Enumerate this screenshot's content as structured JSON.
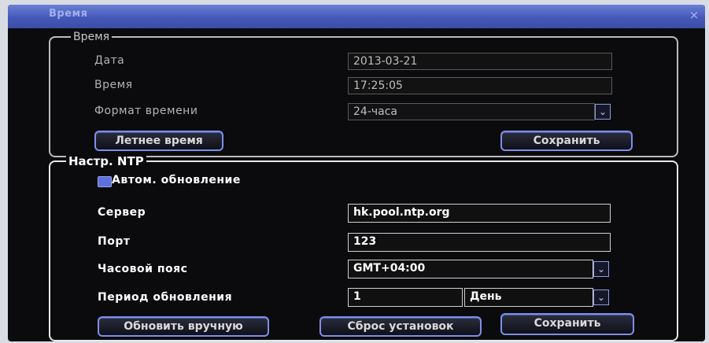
{
  "window": {
    "title": "Время",
    "close_glyph": "×"
  },
  "time_section": {
    "title": "Время",
    "date": {
      "label": "Дата",
      "value": "2013-03-21"
    },
    "time": {
      "label": "Время",
      "value": "17:25:05"
    },
    "format": {
      "label": "Формат времени",
      "value": "24-часа",
      "dropdown_glyph": "⌄"
    },
    "dst_button": "Летнее время",
    "save_button": "Сохранить"
  },
  "ntp_section": {
    "title": "Настр. NTP",
    "auto_update": {
      "label": "Автом. обновление",
      "checked": true
    },
    "server": {
      "label": "Сервер",
      "value": "hk.pool.ntp.org"
    },
    "port": {
      "label": "Порт",
      "value": "123"
    },
    "timezone": {
      "label": "Часовой пояс",
      "value": "GMT+04:00",
      "dropdown_glyph": "⌄"
    },
    "update_period": {
      "label": "Период обновления",
      "value": "1",
      "unit": "День",
      "dropdown_glyph": "⌄"
    },
    "manual_update_button": "Обновить вручную",
    "reset_button": "Сброс установок",
    "save_button": "Сохранить"
  },
  "colors": {
    "accent": "#7e8fe6",
    "titlebar": "#4458b8",
    "background": "#0b0b0d"
  }
}
